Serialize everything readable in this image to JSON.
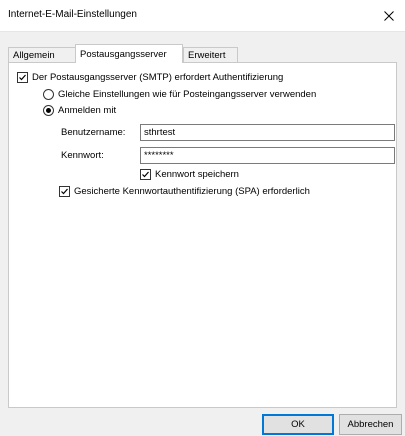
{
  "window": {
    "title": "Internet-E-Mail-Einstellungen"
  },
  "tabs": [
    {
      "label": "Allgemein"
    },
    {
      "label": "Postausgangsserver"
    },
    {
      "label": "Erweitert"
    }
  ],
  "smtp_auth": {
    "label": "Der Postausgangsserver (SMTP) erfordert Authentifizierung",
    "checked": true
  },
  "same_settings": {
    "label": "Gleiche Einstellungen wie für Posteingangsserver verwenden",
    "selected": false
  },
  "logon_with": {
    "label": "Anmelden mit",
    "selected": true
  },
  "username": {
    "label": "Benutzername:",
    "value": "sthrtest"
  },
  "password": {
    "label": "Kennwort:",
    "value": "********"
  },
  "remember_password": {
    "label": "Kennwort speichern",
    "checked": true
  },
  "spa": {
    "label": "Gesicherte Kennwortauthentifizierung (SPA) erforderlich",
    "checked": true
  },
  "buttons": {
    "ok": "OK",
    "cancel": "Abbrechen"
  },
  "icons": {
    "close": "close-icon",
    "check": "check-icon"
  },
  "colors": {
    "accent": "#0078d7",
    "panel": "#ffffff",
    "window": "#f0f0f0"
  }
}
